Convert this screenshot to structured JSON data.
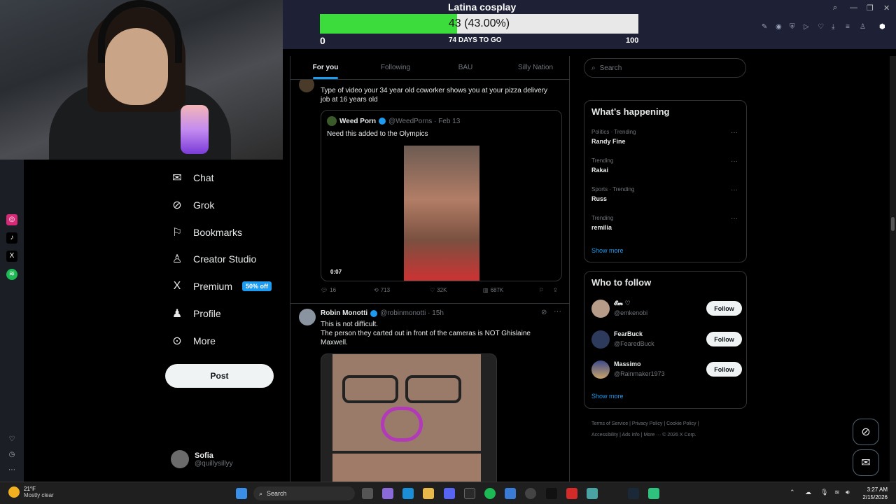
{
  "overlay": {
    "title": "Latina cosplay",
    "current_text": "43 (43.00%)",
    "progress_fraction": 0.43,
    "min": "0",
    "days": "74 DAYS TO GO",
    "max": "100",
    "fill_color": "#3cdc3c"
  },
  "sidebar": {
    "items": [
      {
        "label": "Chat",
        "icon": "mail-icon"
      },
      {
        "label": "Grok",
        "icon": "grok-icon"
      },
      {
        "label": "Bookmarks",
        "icon": "bookmark-icon"
      },
      {
        "label": "Creator Studio",
        "icon": "creator-icon"
      },
      {
        "label": "Premium",
        "icon": "x-logo-icon",
        "badge": "50% off"
      },
      {
        "label": "Profile",
        "icon": "person-icon"
      },
      {
        "label": "More",
        "icon": "more-circle-icon"
      }
    ],
    "post_label": "Post",
    "user": {
      "name": "Sofia",
      "handle": "@quillysillyy"
    }
  },
  "feed": {
    "tabs": [
      "For you",
      "Following",
      "BAU",
      "Silly Nation"
    ],
    "tweet1": {
      "text": "Type of video your 34 year old coworker shows you at your pizza delivery job at 16 years old",
      "quote": {
        "name": "Weed Porn",
        "handle": "@WeedPorns · Feb 13",
        "text": "Need this added to the Olympics",
        "duration": "0:07"
      },
      "replies": "16",
      "reposts": "713",
      "likes": "32K",
      "views": "687K"
    },
    "tweet2": {
      "name": "Robin Monotti",
      "handle": "@robinmonotti · 15h",
      "line1": "This is not difficult.",
      "line2": "The person they carted out in front of the cameras is NOT Ghislaine Maxwell."
    }
  },
  "right": {
    "search_placeholder": "Search",
    "happening_title": "What’s happening",
    "trends": [
      {
        "context": "Politics · Trending",
        "title": "Randy Fine"
      },
      {
        "context": "Trending",
        "title": "Rakai"
      },
      {
        "context": "Sports · Trending",
        "title": "Russ"
      },
      {
        "context": "Trending",
        "title": "remilia"
      }
    ],
    "show_more": "Show more",
    "who_title": "Who to follow",
    "follow": [
      {
        "name": "𝓔𝓶 ♡",
        "handle": "@emkenobi",
        "btn": "Follow"
      },
      {
        "name": "FearBuck",
        "handle": "@FearedBuck",
        "btn": "Follow"
      },
      {
        "name": "Massimo",
        "handle": "@Rainmaker1973",
        "btn": "Follow"
      }
    ],
    "footer1": "Terms of Service  |  Privacy Policy  |  Cookie Policy  |",
    "footer2": "Accessibility  |  Ads info  |  More ···  © 2026 X Corp."
  },
  "taskbar": {
    "temp": "21°F",
    "weather": "Mostly clear",
    "search": "Search",
    "time": "3:27 AM",
    "date": "2/15/2026"
  }
}
